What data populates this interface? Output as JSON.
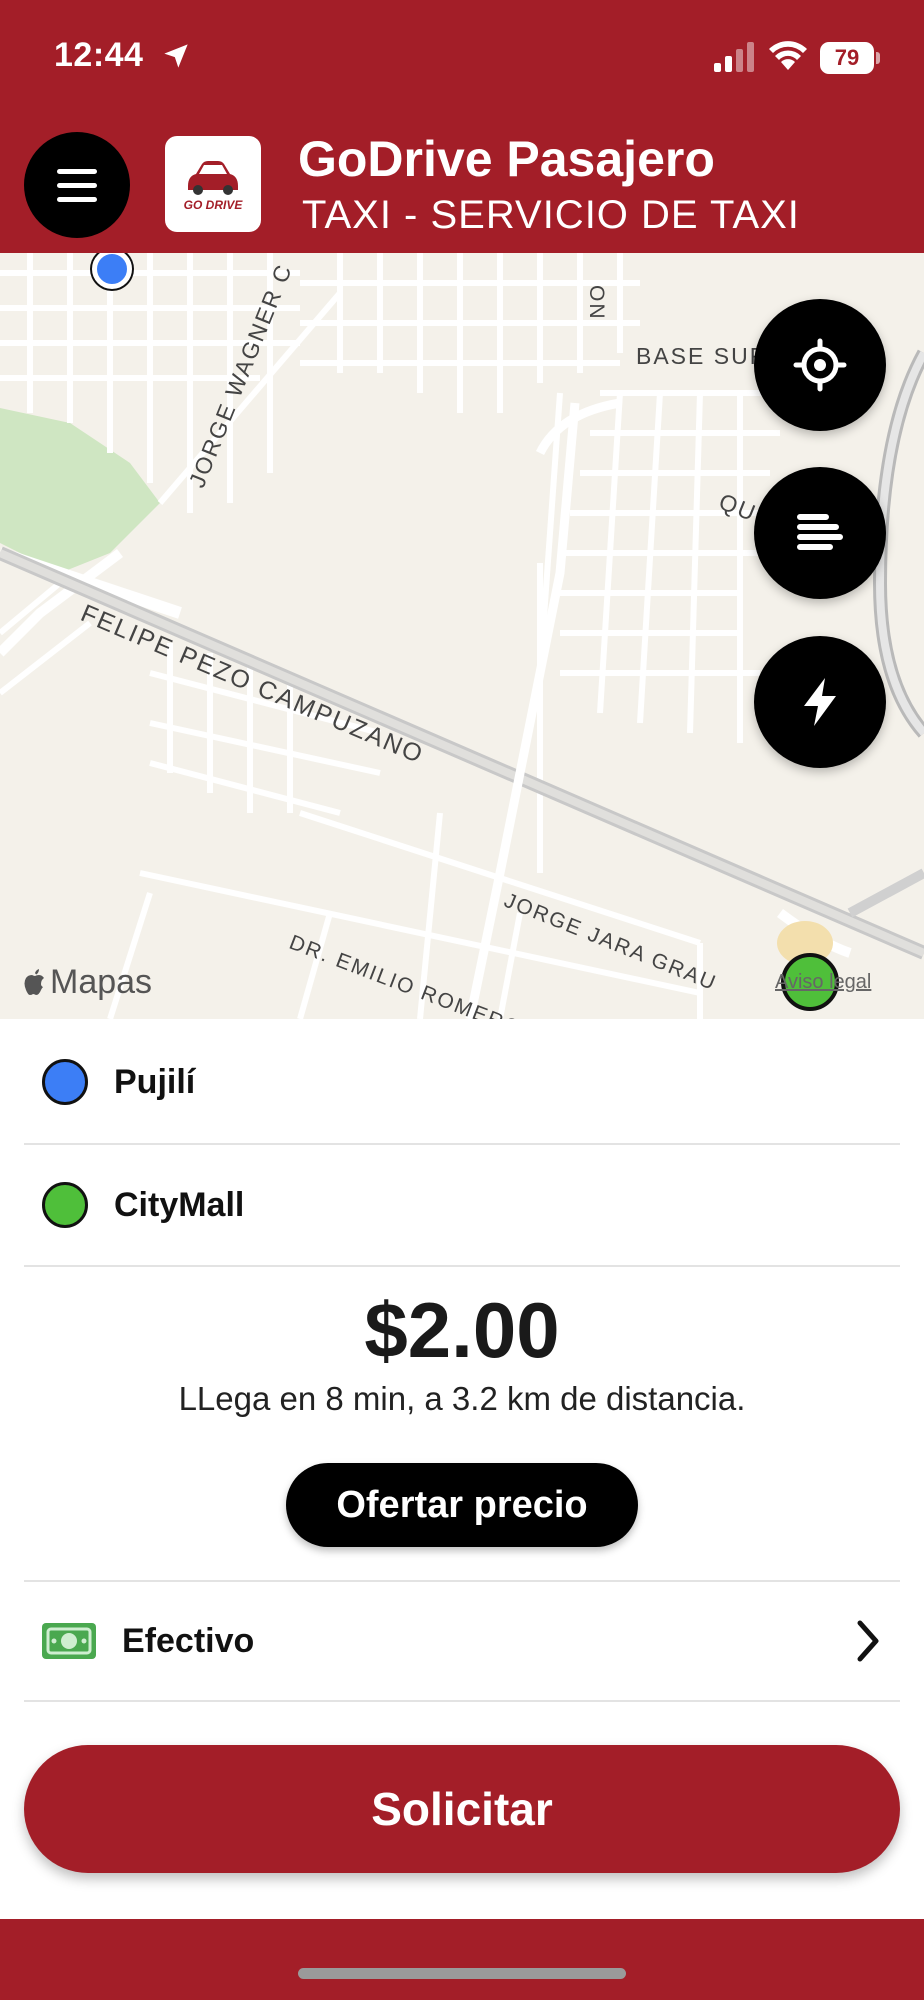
{
  "status_bar": {
    "time": "12:44",
    "battery": "79",
    "icons": [
      "location-arrow-icon",
      "cellular-signal-icon",
      "wifi-icon",
      "battery-icon"
    ]
  },
  "header": {
    "title": "GoDrive Pasajero",
    "subtitle": "TAXI - SERVICIO DE TAXI",
    "logo_text": "GO DRIVE",
    "menu_icon": "hamburger-menu-icon",
    "brand_color": "#a31e28"
  },
  "map": {
    "labels": {
      "street_1": "JORGE WAGNER C",
      "street_2": "BASE SUR",
      "street_3": "FELIPE PEZO CAMPUZANO",
      "street_4": "QUIJ",
      "street_5": "JORGE JARA GRAU",
      "street_6": "DR. EMILIO ROMERO",
      "street_7": "ON"
    },
    "brand": "Mapas",
    "legal": "Aviso legal",
    "buttons": [
      "crosshair-icon",
      "list-lines-icon",
      "lightning-icon"
    ]
  },
  "trip": {
    "origin": "Pujilí",
    "destination": "CityMall",
    "origin_color": "#3c7ef6",
    "destination_color": "#4fbf3a",
    "price": "$2.00",
    "eta": "LLega en  8 min, a 3.2 km de distancia.",
    "offer_label": "Ofertar precio",
    "payment_method": "Efectivo",
    "request_label": "Solicitar"
  }
}
